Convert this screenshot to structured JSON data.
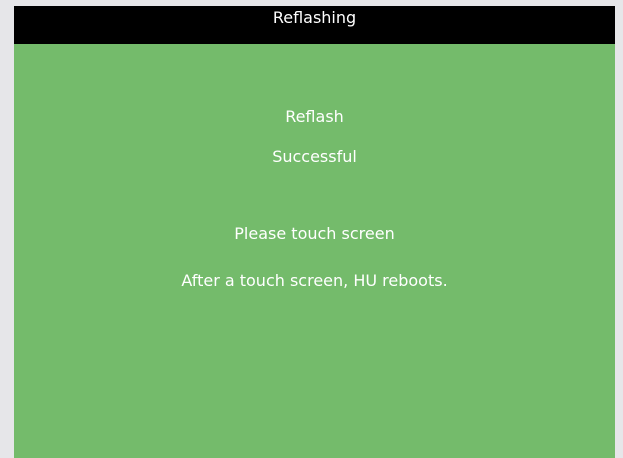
{
  "header": {
    "title": "Reflashing"
  },
  "status": {
    "line1": "Reflash",
    "line2": "Successful",
    "instruction": "Please touch screen",
    "note": "After a touch screen, HU reboots."
  },
  "colors": {
    "title_bar": "#000000",
    "screen_background": "#74bb6b",
    "text": "#ffffff",
    "outer_frame": "#e6e6e9"
  }
}
